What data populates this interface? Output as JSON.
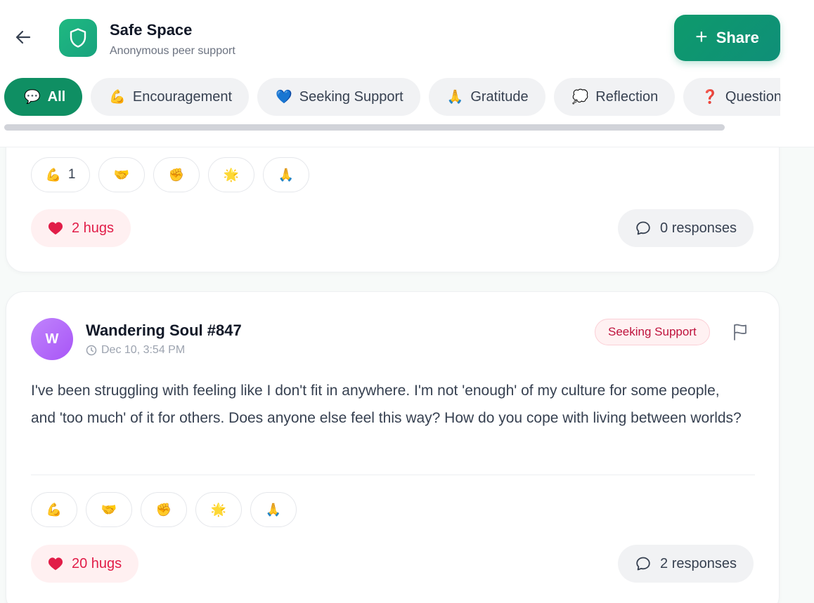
{
  "header": {
    "title": "Safe Space",
    "subtitle": "Anonymous peer support",
    "share_label": "Share",
    "back_icon": "arrow-left-icon",
    "logo_icon": "shield-icon"
  },
  "categories": [
    {
      "emoji": "💬",
      "label": "All",
      "active": true
    },
    {
      "emoji": "💪",
      "label": "Encouragement"
    },
    {
      "emoji": "💙",
      "label": "Seeking Support"
    },
    {
      "emoji": "🙏",
      "label": "Gratitude"
    },
    {
      "emoji": "💭",
      "label": "Reflection"
    },
    {
      "emoji": "❓",
      "label": "Questions"
    }
  ],
  "posts": [
    {
      "reactions": [
        {
          "emoji": "💪",
          "count": "1"
        },
        {
          "emoji": "🤝",
          "count": ""
        },
        {
          "emoji": "✊",
          "count": ""
        },
        {
          "emoji": "🌟",
          "count": ""
        },
        {
          "emoji": "🙏",
          "count": ""
        }
      ],
      "hugs": "2 hugs",
      "responses": "0 responses"
    },
    {
      "avatar_initial": "W",
      "author": "Wandering Soul #847",
      "time": "Dec 10, 3:54 PM",
      "tag": "Seeking Support",
      "text": "I've been struggling with feeling like I don't fit in anywhere. I'm not 'enough' of my culture for some people, and 'too much' of it for others. Does anyone else feel this way? How do you cope with living between worlds?",
      "reactions": [
        {
          "emoji": "💪",
          "count": ""
        },
        {
          "emoji": "🤝",
          "count": ""
        },
        {
          "emoji": "✊",
          "count": ""
        },
        {
          "emoji": "🌟",
          "count": ""
        },
        {
          "emoji": "🙏",
          "count": ""
        }
      ],
      "hugs": "20 hugs",
      "responses": "2 responses"
    }
  ],
  "colors": {
    "brand": "#0f8f63",
    "hug": "#e11d48",
    "tag": "#be123c"
  }
}
